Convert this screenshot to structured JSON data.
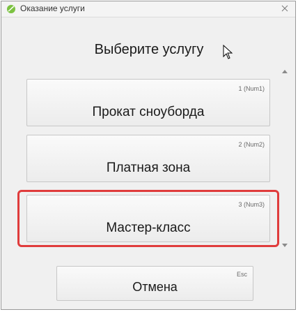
{
  "window": {
    "title": "Оказание услуги",
    "close_symbol": "⨯"
  },
  "dialog": {
    "heading": "Выберите услугу"
  },
  "services": [
    {
      "label": "Прокат сноуборда",
      "hotkey": "1 (Num1)"
    },
    {
      "label": "Платная зона",
      "hotkey": "2 (Num2)"
    },
    {
      "label": "Мастер-класс",
      "hotkey": "3 (Num3)"
    }
  ],
  "highlighted_service": "Мастер-класс",
  "cancel": {
    "label": "Отмена",
    "hotkey": "Esc"
  },
  "icons": {
    "app": "leaf-app-icon",
    "close": "close-icon",
    "cursor": "mouse-cursor-icon",
    "scroll_up": "scroll-up-arrow-icon",
    "scroll_down": "scroll-down-arrow-icon"
  },
  "colors": {
    "highlight_border": "#e03c3c",
    "app_icon_green": "#7cc242"
  }
}
